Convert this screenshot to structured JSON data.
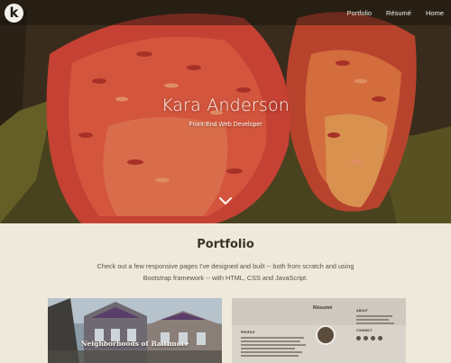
{
  "nav": {
    "logo_letter": "k",
    "links": [
      "Portfolio",
      "Résumé",
      "Home"
    ]
  },
  "hero": {
    "name": "Kara Anderson",
    "tagline": "Front-End Web Developer",
    "scroll_icon": "chevron-down-icon"
  },
  "portfolio": {
    "title": "Portfolio",
    "description": "Check out a few responsive pages I've designed and built -- both from scratch and using Bootstrap framework -- with HTML, CSS and JavaScript.",
    "cards": [
      {
        "caption": "Neighborhoods of Baltimore"
      },
      {
        "heading": "Résumé",
        "labels": [
          "PROFILE",
          "ABOUT",
          "CONNECT"
        ]
      }
    ]
  },
  "colors": {
    "page_bg": "#efe9db",
    "accent_flower": "#e8533a",
    "text_dark": "#3b3226"
  }
}
